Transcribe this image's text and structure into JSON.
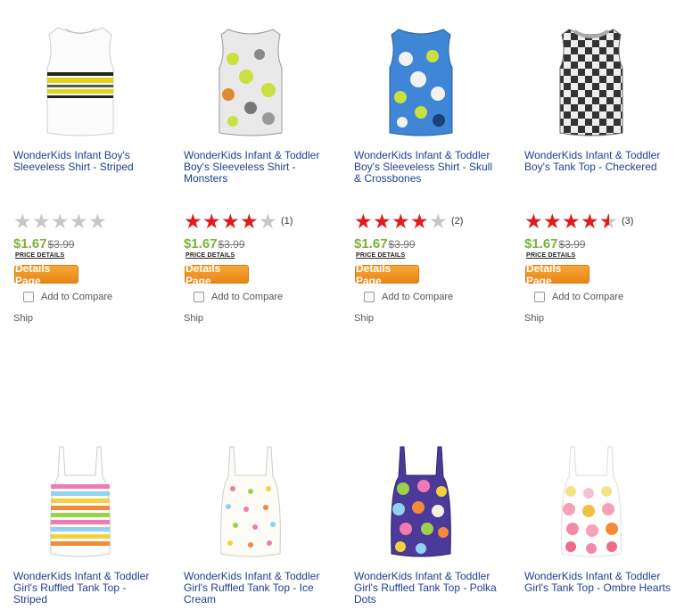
{
  "details_label": "Details Page",
  "price_details_label": "PRICE DETAILS",
  "compare_label": "Add to Compare",
  "ship_label": "Ship",
  "colors": {
    "title": "#1f3f8f",
    "price": "#7ab338",
    "star": "#e01b1b",
    "button": "#f39a27"
  },
  "products": [
    {
      "title": "WonderKids Infant Boy's Sleeveless Shirt - Striped",
      "rating": 0,
      "count": "",
      "price": "$1.67",
      "was": "$3.99",
      "image": "striped-sleeveless-shirt"
    },
    {
      "title": "WonderKids Infant & Toddler Boy's Sleeveless Shirt - Monsters",
      "rating": 4,
      "count": "(1)",
      "price": "$1.67",
      "was": "$3.99",
      "image": "monsters-sleeveless-shirt"
    },
    {
      "title": "WonderKids Infant & Toddler Boy's Sleeveless Shirt - Skull & Crossbones",
      "rating": 4,
      "count": "(2)",
      "price": "$1.67",
      "was": "$3.99",
      "image": "skull-sleeveless-shirt"
    },
    {
      "title": "WonderKids Infant & Toddler Boy's Tank Top - Checkered",
      "rating": 4.5,
      "count": "(3)",
      "price": "$1.67",
      "was": "$3.99",
      "image": "checkered-tank-top"
    },
    {
      "title": "WonderKids Infant & Toddler Girl's Ruffled Tank Top - Striped",
      "image": "striped-ruffled-tank"
    },
    {
      "title": "WonderKids Infant & Toddler Girl's Ruffled Tank Top - Ice Cream",
      "image": "ice-cream-ruffled-tank"
    },
    {
      "title": "WonderKids Infant & Toddler Girl's Ruffled Tank Top - Polka Dots",
      "image": "polka-dot-ruffled-tank"
    },
    {
      "title": "WonderKids Infant & Toddler Girl's Tank Top - Ombre Hearts",
      "image": "ombre-hearts-tank"
    }
  ]
}
